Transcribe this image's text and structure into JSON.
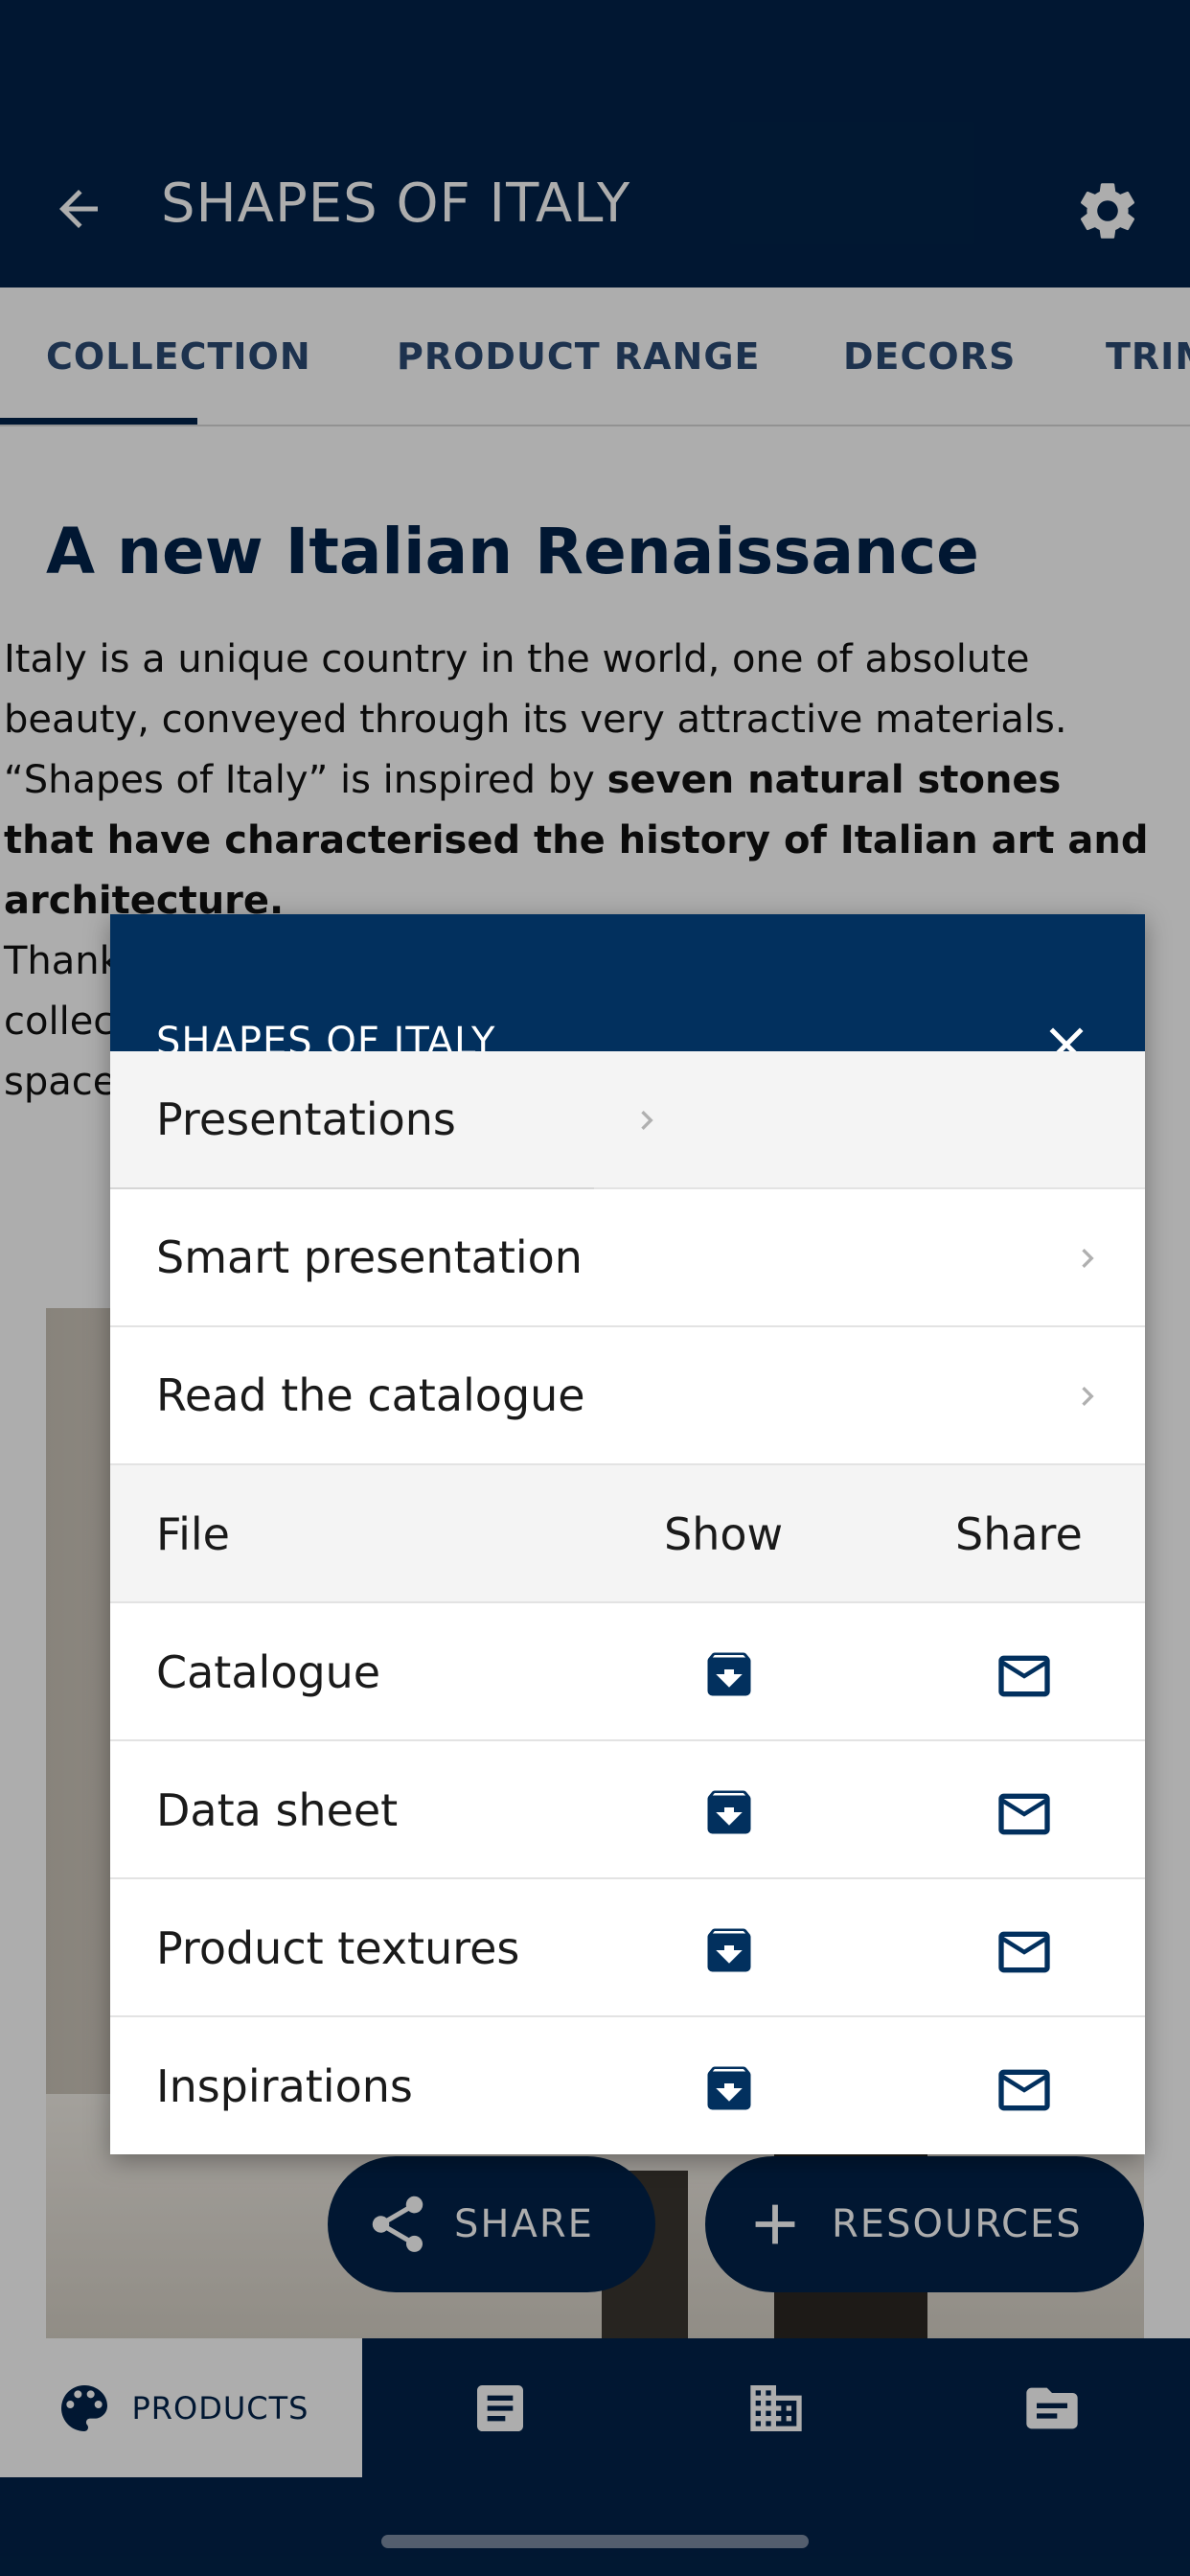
{
  "app_bar": {
    "title": "SHAPES OF ITALY"
  },
  "tabs": [
    {
      "label": "COLLECTION"
    },
    {
      "label": "PRODUCT RANGE"
    },
    {
      "label": "DECORS"
    },
    {
      "label": "TRIM"
    }
  ],
  "content": {
    "headline": "A new Italian Renaissance",
    "para_1": "Italy is a unique country in the world, one of absolute beauty, conveyed through its very attractive materials. “Shapes of Italy” is inspired by ",
    "para_1_bold": "seven natural stones that have characterised the history of Italian art and architecture.",
    "para_2_line_1": "Thank",
    "para_2_line_2": "collec",
    "para_2_line_3": "space"
  },
  "fabs": {
    "share_label": "SHARE",
    "resources_label": "RESOURCES"
  },
  "bottom_nav": {
    "products_label": "PRODUCTS"
  },
  "dialog": {
    "title": "SHAPES OF ITALY",
    "rows": [
      {
        "label": "Presentations"
      },
      {
        "label": "Smart presentation"
      },
      {
        "label": "Read the catalogue"
      }
    ],
    "table": {
      "headers": {
        "file": "File",
        "show": "Show",
        "share": "Share"
      },
      "files": [
        {
          "name": "Catalogue"
        },
        {
          "name": "Data sheet"
        },
        {
          "name": "Product textures"
        },
        {
          "name": "Inspirations"
        }
      ]
    }
  },
  "colors": {
    "primary": "#02234a",
    "dialog_header": "#02305e",
    "accent_text": "#2b4b74"
  },
  "icons": [
    "arrow-back-icon",
    "gear-icon",
    "close-icon",
    "chevron-right-icon",
    "archive-download-icon",
    "mail-icon",
    "share-icon",
    "plus-icon",
    "palette-icon",
    "article-icon",
    "building-icon",
    "folder-icon"
  ]
}
